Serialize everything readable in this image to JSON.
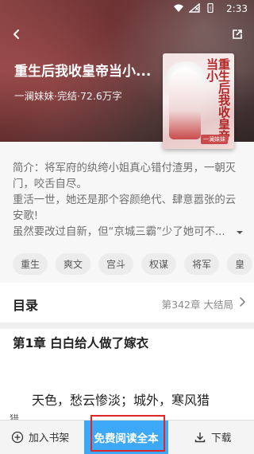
{
  "status_bar": {
    "time": "2:33"
  },
  "header": {
    "title": "重生后我收皇帝当小...",
    "meta": "一澜妹妹·完结·72.6万字"
  },
  "cover": {
    "text": "重生后我收皇帝当小",
    "badge": "一澜妹妹"
  },
  "intro": {
    "line1": "简介：将军府的纨绔小姐真心错付渣男，一朝灭门，咬舌自尽。",
    "line2": "重活一世，她还是那个容颜绝代、肆意嚣张的云安歌!",
    "line3": "虽然要改过自新，但“京城三霸”少了她可不..."
  },
  "tags": [
    "重生",
    "爽文",
    "宫斗",
    "权谋",
    "将军",
    "皇"
  ],
  "toc": {
    "label": "目录",
    "latest": "第342章 大结局"
  },
  "chapter": {
    "title": "第1章 白白给人做了嫁衣",
    "text": "天色，愁云惨淡；城外，寒风猎",
    "text2": "猎"
  },
  "bottom_bar": {
    "add_shelf": "加入书架",
    "read_free": "免费阅读全本",
    "download": "下载"
  },
  "colors": {
    "accent": "#3da8f5",
    "highlight_box": "#e0262a"
  }
}
